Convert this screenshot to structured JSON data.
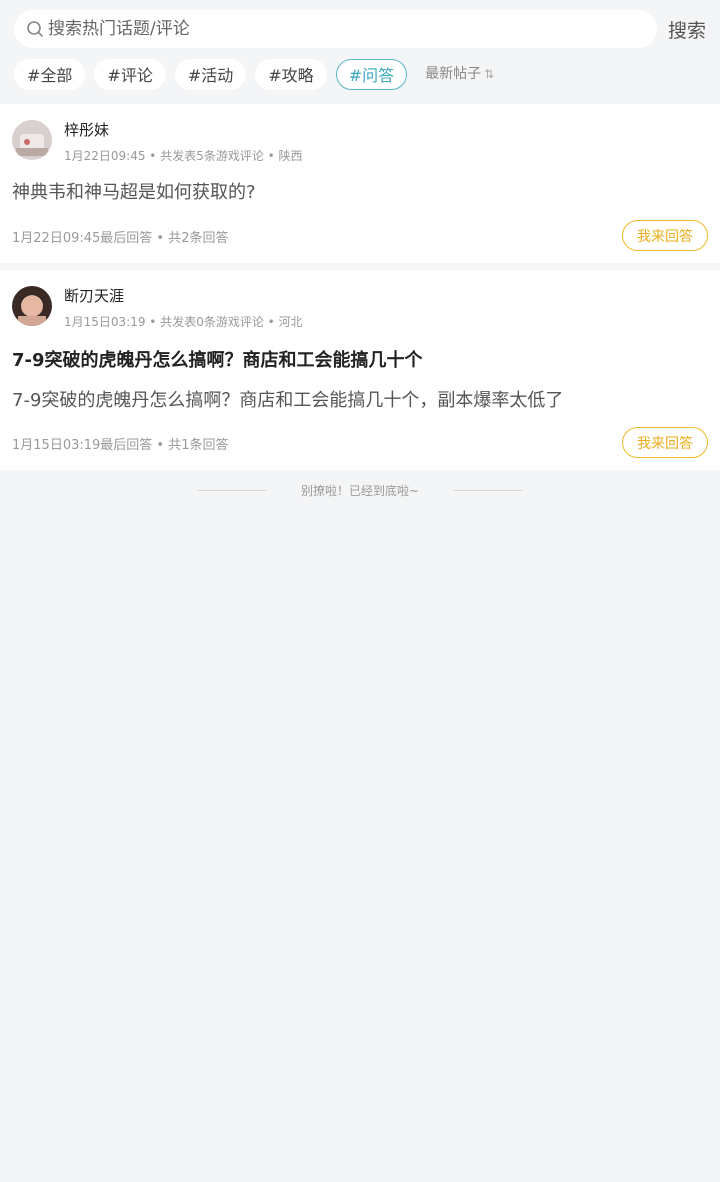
{
  "search": {
    "placeholder": "搜索热门话题/评论",
    "button_label": "搜索"
  },
  "tags": [
    {
      "label": "#全部",
      "active": false
    },
    {
      "label": "#评论",
      "active": false
    },
    {
      "label": "#活动",
      "active": false
    },
    {
      "label": "#攻略",
      "active": false
    },
    {
      "label": "#问答",
      "active": true
    }
  ],
  "sort": {
    "label": "最新帖子",
    "icon": "sort-arrows-icon"
  },
  "posts": [
    {
      "username": "梓彤妹",
      "meta": "1月22日09:45 • 共发表5条游戏评论 • 陕西",
      "title": "",
      "body": "神典韦和神马超是如何获取的?",
      "footer": "1月22日09:45最后回答 • 共2条回答",
      "answer_label": "我来回答"
    },
    {
      "username": "断刃天涯",
      "meta": "1月15日03:19 • 共发表0条游戏评论 • 河北",
      "title": "7-9突破的虎魄丹怎么搞啊？商店和工会能搞几十个",
      "body": "7-9突破的虎魄丹怎么搞啊？商店和工会能搞几十个，副本爆率太低了",
      "footer": "1月15日03:19最后回答 • 共1条回答",
      "answer_label": "我来回答"
    }
  ],
  "end_tip": "别撩啦！已经到底啦~",
  "colors": {
    "accent": "#3aa8bf",
    "answer": "#e9ae1c",
    "background": "#f4f5f7"
  }
}
